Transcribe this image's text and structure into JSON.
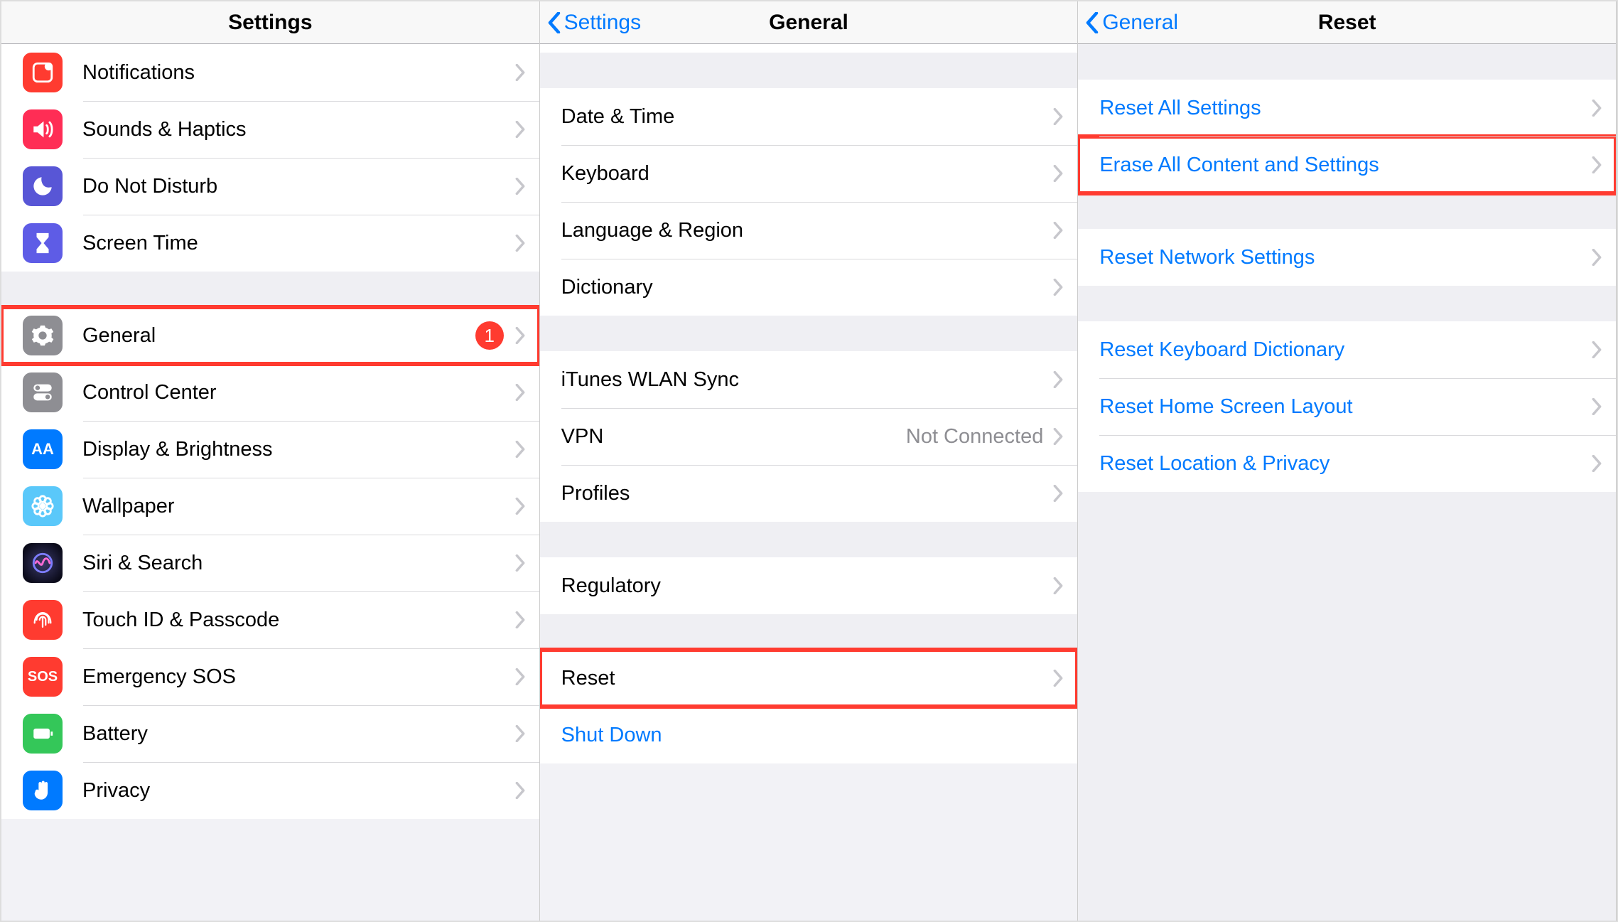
{
  "panel1": {
    "title": "Settings",
    "group1": [
      {
        "id": "notifications",
        "label": "Notifications",
        "iconClass": "ic-red",
        "icon": "notifications"
      },
      {
        "id": "sounds",
        "label": "Sounds & Haptics",
        "iconClass": "ic-pink",
        "icon": "sounds"
      },
      {
        "id": "dnd",
        "label": "Do Not Disturb",
        "iconClass": "ic-purple",
        "icon": "moon"
      },
      {
        "id": "screentime",
        "label": "Screen Time",
        "iconClass": "ic-violet",
        "icon": "hourglass"
      }
    ],
    "group2": [
      {
        "id": "general",
        "label": "General",
        "iconClass": "ic-gray",
        "icon": "gear",
        "badge": "1",
        "highlight": true
      },
      {
        "id": "controlcenter",
        "label": "Control Center",
        "iconClass": "ic-gray",
        "icon": "toggles"
      },
      {
        "id": "display",
        "label": "Display & Brightness",
        "iconClass": "ic-blue",
        "icon": "aa"
      },
      {
        "id": "wallpaper",
        "label": "Wallpaper",
        "iconClass": "ic-teal",
        "icon": "flower"
      },
      {
        "id": "siri",
        "label": "Siri & Search",
        "iconClass": "ic-dark",
        "icon": "siri"
      },
      {
        "id": "touchid",
        "label": "Touch ID & Passcode",
        "iconClass": "ic-red",
        "icon": "fingerprint"
      },
      {
        "id": "sos",
        "label": "Emergency SOS",
        "iconClass": "ic-red",
        "icon": "sos"
      },
      {
        "id": "battery",
        "label": "Battery",
        "iconClass": "ic-green",
        "icon": "battery"
      },
      {
        "id": "privacy",
        "label": "Privacy",
        "iconClass": "ic-blue",
        "icon": "hand"
      }
    ]
  },
  "panel2": {
    "back": "Settings",
    "title": "General",
    "groupA": [
      {
        "id": "datetime",
        "label": "Date & Time"
      },
      {
        "id": "keyboard",
        "label": "Keyboard"
      },
      {
        "id": "language",
        "label": "Language & Region"
      },
      {
        "id": "dictionary",
        "label": "Dictionary"
      }
    ],
    "groupB": [
      {
        "id": "itunes",
        "label": "iTunes WLAN Sync"
      },
      {
        "id": "vpn",
        "label": "VPN",
        "value": "Not Connected"
      },
      {
        "id": "profiles",
        "label": "Profiles"
      }
    ],
    "groupC": [
      {
        "id": "regulatory",
        "label": "Regulatory"
      }
    ],
    "groupD": [
      {
        "id": "reset",
        "label": "Reset",
        "highlight": true
      },
      {
        "id": "shutdown",
        "label": "Shut Down",
        "link": true,
        "noChevron": true
      }
    ]
  },
  "panel3": {
    "back": "General",
    "title": "Reset",
    "groupA": [
      {
        "id": "resetall",
        "label": "Reset All Settings"
      },
      {
        "id": "eraseall",
        "label": "Erase All Content and Settings",
        "highlight": true
      }
    ],
    "groupB": [
      {
        "id": "resetnetwork",
        "label": "Reset Network Settings"
      }
    ],
    "groupC": [
      {
        "id": "resetkeyboard",
        "label": "Reset Keyboard Dictionary"
      },
      {
        "id": "resethome",
        "label": "Reset Home Screen Layout"
      },
      {
        "id": "resetlocation",
        "label": "Reset Location & Privacy"
      }
    ]
  }
}
